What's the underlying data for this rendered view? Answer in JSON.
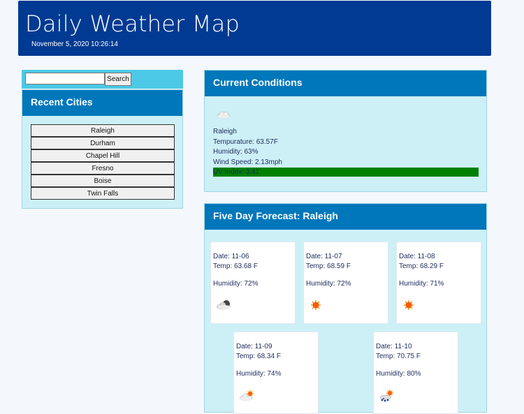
{
  "header": {
    "title": "Daily Weather Map",
    "date": "November 5, 2020 10:26:14"
  },
  "search": {
    "value": "",
    "placeholder": "",
    "button_label": "Search"
  },
  "recent": {
    "title": "Recent Cities",
    "cities": [
      "Raleigh",
      "Durham",
      "Chapel Hill",
      "Fresno",
      "Boise",
      "Twin Falls"
    ]
  },
  "current": {
    "title": "Current Conditions",
    "icon": "cloud-icon",
    "city": "Raleigh",
    "temperature": "Tempurature: 63.57F",
    "humidity": "Humidity: 63%",
    "wind": "Wind Speed: 2.13mph",
    "uv": "UV Index: 3.41",
    "uv_color": "#008000"
  },
  "forecast": {
    "title": "Five Day Forecast: Raleigh",
    "days": [
      {
        "date": "Date: 11-06",
        "temp": "Temp: 63.68 F",
        "humidity": "Humidity: 72%",
        "icon": "rain-cloud-icon"
      },
      {
        "date": "Date: 11-07",
        "temp": "Temp: 68.59 F",
        "humidity": "Humidity: 72%",
        "icon": "sun-icon"
      },
      {
        "date": "Date: 11-08",
        "temp": "Temp: 68.29 F",
        "humidity": "Humidity: 71%",
        "icon": "sun-icon"
      },
      {
        "date": "Date: 11-09",
        "temp": "Temp: 68.34 F",
        "humidity": "Humidity: 74%",
        "icon": "partly-cloudy-icon"
      },
      {
        "date": "Date: 11-10",
        "temp": "Temp: 70.75 F",
        "humidity": "Humidity: 80%",
        "icon": "sun-rain-cloud-icon"
      }
    ]
  },
  "colors": {
    "header_bg": "#003a92",
    "panel_title_bg": "#0077bb",
    "panel_bg": "#cdf0f7",
    "search_bar_bg": "#4cc9e6"
  }
}
